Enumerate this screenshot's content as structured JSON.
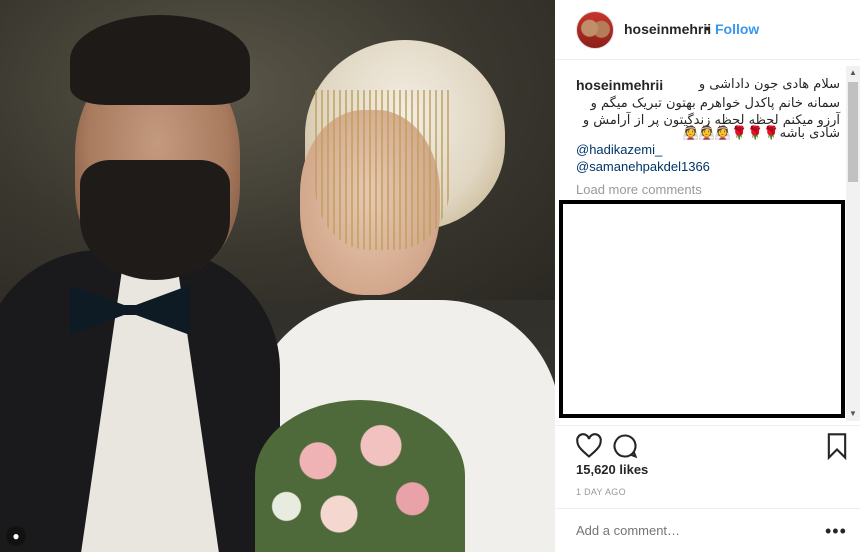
{
  "post": {
    "username": "hoseinmehrii",
    "separator": "•",
    "follow_label": "Follow"
  },
  "caption": {
    "username": "hoseinmehrii",
    "lines": [
      "سلام هادی جون داداشی و",
      "سمانه خانم پاکدل خواهرم بهتون تبریک میگم و",
      "آرزو میکنم لحظه لحظه زندگیتون پر از آرامش و",
      "شادی باشه🌹🌹🌹👰👰👰"
    ],
    "mentions": [
      "@hadikazemi_",
      "@samanehpakdel1366"
    ]
  },
  "comments": {
    "load_more_label": "Load more comments"
  },
  "stats": {
    "likes": "15,620 likes",
    "time_ago": "1 DAY AGO"
  },
  "add_comment": {
    "placeholder": "Add a comment…",
    "more_label": "•••"
  },
  "icons": {
    "like": "heart-icon",
    "comment": "comment-icon",
    "save": "bookmark-icon",
    "more": "more-options-icon"
  },
  "colors": {
    "link": "#3897f0",
    "mention": "#003569",
    "muted": "#999999",
    "text": "#262626"
  }
}
